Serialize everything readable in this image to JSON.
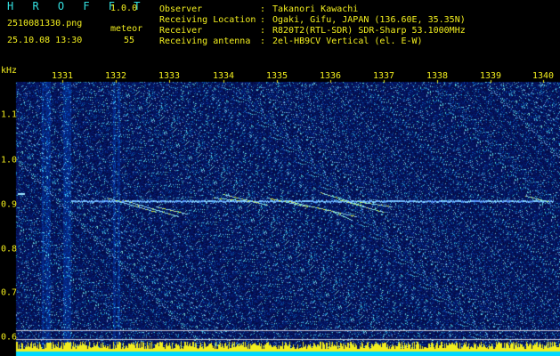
{
  "header": {
    "app_title": "H R O F F T",
    "app_version": "1.0.0",
    "file_name": "2510081330.png",
    "datetime": "25.10.08 13:30",
    "detection_label": "meteor",
    "detection_count": "55",
    "info": [
      {
        "label": "Observer",
        "value": "Takanori Kawachi"
      },
      {
        "label": "Receiving Location",
        "value": "Ogaki, Gifu, JAPAN (136.60E, 35.35N)"
      },
      {
        "label": "Receiver",
        "value": "R820T2(RTL-SDR) SDR-Sharp 53.1000MHz"
      },
      {
        "label": "Receiving antenna",
        "value": "2el-HB9CV Vertical (el. E-W)"
      }
    ]
  },
  "axes": {
    "y_unit": "kHz",
    "x_ticks": [
      "1331",
      "1332",
      "1333",
      "1334",
      "1335",
      "1336",
      "1337",
      "1338",
      "1339",
      "1340"
    ],
    "y_ticks": [
      "1.1",
      "1.0",
      "0.9",
      "0.8",
      "0.7",
      "0.6"
    ]
  },
  "colors": {
    "text": "#f2ee1e",
    "title": "#33e0e0",
    "background_noise": "#0a1466",
    "signal": "#aaf0ff",
    "level_bar": "#f2ee1e",
    "baseline": "#00d8ff"
  }
}
